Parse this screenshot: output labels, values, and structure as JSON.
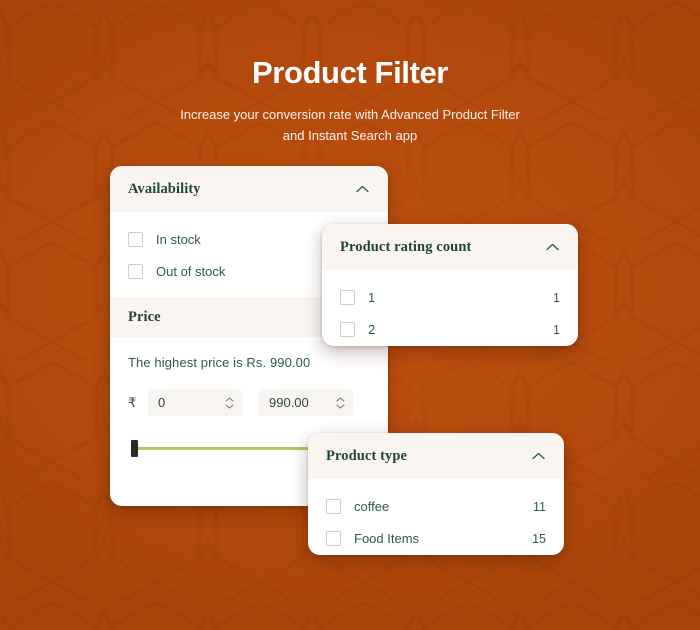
{
  "header": {
    "title": "Product Filter",
    "subtitle_line1": "Increase your conversion rate with Advanced Product Filter",
    "subtitle_line2": "and Instant Search app"
  },
  "colors": {
    "background": "#b84c0d",
    "card_background": "#ffffff",
    "panel_header_background": "#faf5f1",
    "heading_text": "#1f4637",
    "label_text": "#2f5a4a",
    "slider_track": "#b7c75e",
    "slider_handle": "#2b2b2b"
  },
  "availability_panel": {
    "title": "Availability",
    "toggle_icon": "chevron-up-icon",
    "options": [
      {
        "label": "In stock"
      },
      {
        "label": "Out of stock"
      }
    ]
  },
  "price_panel": {
    "title": "Price",
    "toggle_icon": "chevron-up-icon",
    "highest_price_text": "The highest price is Rs. 990.00",
    "currency_symbol": "₹",
    "min_value": "0",
    "min_placeholder": "0",
    "max_value": "990.00",
    "max_placeholder": "990.00",
    "stepper_icon": "stepper-updown-icon",
    "slider": {
      "min": 0,
      "max": 990,
      "current": 0
    }
  },
  "rating_panel": {
    "title": "Product rating count",
    "toggle_icon": "chevron-up-icon",
    "options": [
      {
        "label": "1",
        "count": "1"
      },
      {
        "label": "2",
        "count": "1"
      }
    ]
  },
  "producttype_panel": {
    "title": "Product type",
    "toggle_icon": "chevron-up-icon",
    "options": [
      {
        "label": "coffee",
        "count": "11"
      },
      {
        "label": "Food Items",
        "count": "15"
      }
    ]
  }
}
